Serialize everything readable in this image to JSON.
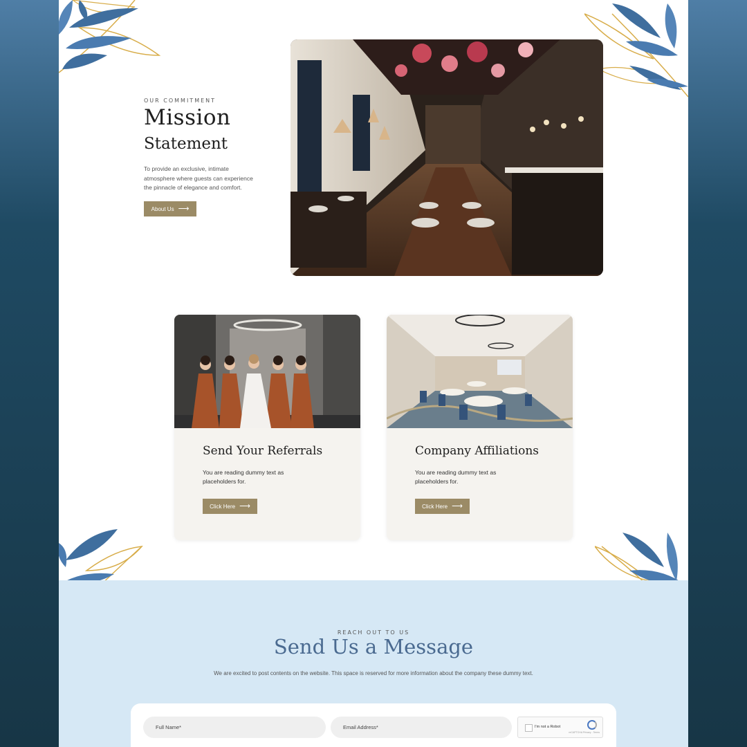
{
  "hero": {
    "eyebrow": "OUR COMMITMENT",
    "title_line1": "Mission",
    "title_line2": "Statement",
    "text": "To provide an exclusive, intimate atmosphere where guests can experience the pinnacle of elegance and comfort.",
    "button_label": "About Us"
  },
  "cards": [
    {
      "title": "Send Your Referrals",
      "text": "You are reading dummy text as placeholders for.",
      "button_label": "Click Here"
    },
    {
      "title": "Company Affiliations",
      "text": "You are reading dummy text as placeholders for.",
      "button_label": "Click Here"
    }
  ],
  "contact": {
    "eyebrow": "REACH OUT TO US",
    "title": "Send Us a Message",
    "text": "We are excited to post contents on the website. This space is reserved for more information about the company these dummy text.",
    "full_name_placeholder": "Full Name*",
    "email_placeholder": "Email Address*",
    "captcha_label": "I'm not a Robot",
    "captcha_fine_print": "reCAPTCHA Privacy - Terms"
  },
  "icons": {
    "button_arrow": "arrow-right-icon",
    "leaf": "leaf-decoration-icon"
  },
  "colors": {
    "accent": "#9b8b66",
    "contact_bg": "#d6e8f5",
    "heading_blue": "#4a6a90",
    "leaf_blue": "#3f6e9e",
    "leaf_gold": "#d8ad4a"
  }
}
